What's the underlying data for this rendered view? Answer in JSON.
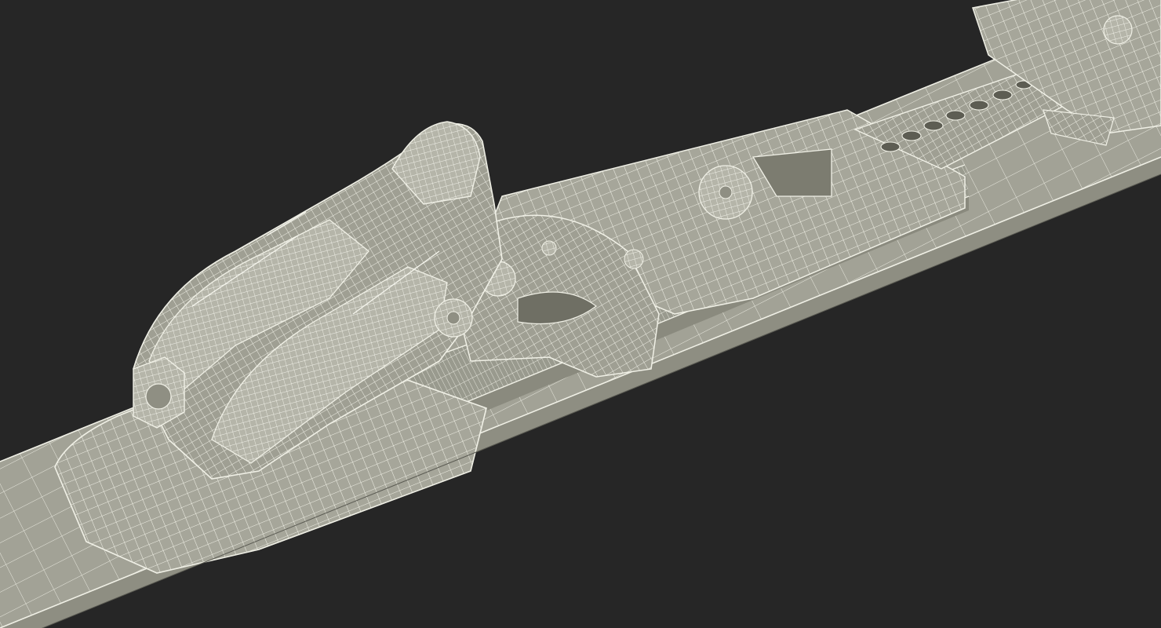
{
  "scene": {
    "subject": "ski-binding-wireframe-render",
    "colors": {
      "background": "#262626",
      "surface": "#a6a69a",
      "surface_light": "#b7b7ab",
      "surface_dark": "#8c8c80",
      "wire": "#eeeee4"
    },
    "parts": {
      "ski_deck": "ski-deck",
      "rail": "slide-rail",
      "heel_unit": "heel-piece",
      "brake_arm": "brake-arm",
      "plate": "binding-plate",
      "adjust_strip": "adjustment-strip",
      "toe_unit": "toe-piece"
    }
  }
}
